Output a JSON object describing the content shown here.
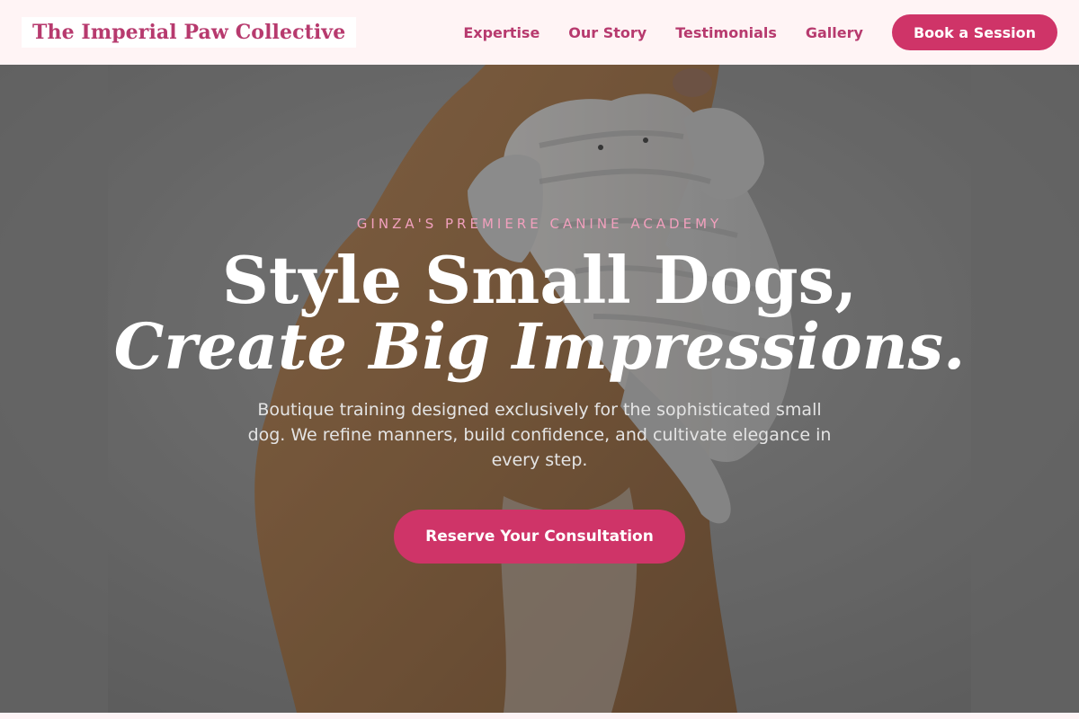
{
  "header": {
    "logo": "The Imperial Paw Collective",
    "nav": [
      {
        "label": "Expertise"
      },
      {
        "label": "Our Story"
      },
      {
        "label": "Testimonials"
      },
      {
        "label": "Gallery"
      }
    ],
    "book_label": "Book a Session"
  },
  "hero": {
    "eyebrow": "GINZA'S PREMIERE CANINE ACADEMY",
    "headline_line1": "Style Small Dogs,",
    "headline_line2": "Create Big Impressions.",
    "subtext": "Boutique training designed exclusively for the sophisticated small dog. We refine manners, build confidence, and cultivate elegance in every step.",
    "cta_label": "Reserve Your Consultation"
  },
  "colors": {
    "accent": "#cf3468",
    "brand_text": "#b73a6e",
    "header_bg": "#fff4f5",
    "eyebrow": "#f1a0bd"
  }
}
